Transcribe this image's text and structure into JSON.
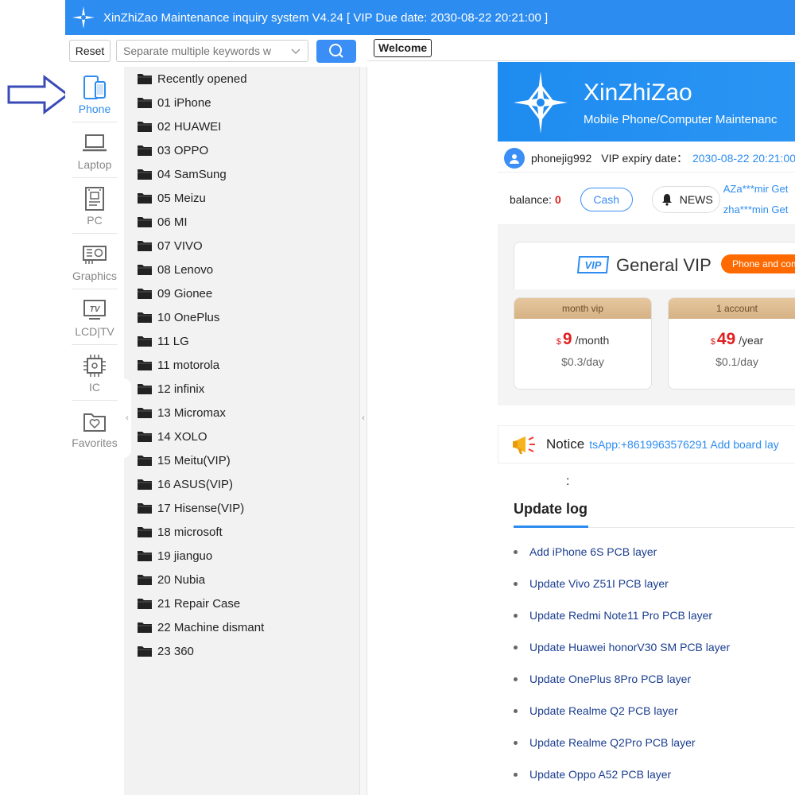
{
  "window": {
    "title": "XinZhiZao Maintenance inquiry system V4.24 [ VIP Due date: 2030-08-22 20:21:00 ]"
  },
  "toolbar": {
    "reset_label": "Reset",
    "search_placeholder": "Separate multiple keywords w"
  },
  "categories": [
    {
      "label": "Phone",
      "icon": "phone-icon",
      "active": true
    },
    {
      "label": "Laptop",
      "icon": "laptop-icon"
    },
    {
      "label": "PC",
      "icon": "motherboard-icon"
    },
    {
      "label": "Graphics",
      "icon": "graphics-card-icon"
    },
    {
      "label": "LCD|TV",
      "icon": "tv-icon"
    },
    {
      "label": "IC",
      "icon": "chip-icon"
    },
    {
      "label": "Favorites",
      "icon": "favorites-icon"
    }
  ],
  "tree": [
    "Recently opened",
    "01 iPhone",
    "02 HUAWEI",
    "03 OPPO",
    "04 SamSung",
    "05 Meizu",
    "06 MI",
    "07 VIVO",
    "08 Lenovo",
    "09 Gionee",
    "10 OnePlus",
    "11 LG",
    "11 motorola",
    "12 infinix",
    "13 Micromax",
    "14 XOLO",
    "15 Meitu(VIP)",
    "16 ASUS(VIP)",
    "17 Hisense(VIP)",
    "18 microsoft",
    "19 jianguo",
    "20 Nubia",
    "21 Repair Case",
    "22 Machine dismant",
    "23 360"
  ],
  "tabs": {
    "welcome": "Welcome"
  },
  "banner": {
    "name": "XinZhiZao",
    "subtitle": "Mobile Phone/Computer Maintenanc"
  },
  "user": {
    "username": "phonejig992",
    "vip_label": "VIP expiry date：",
    "vip_date": "2030-08-22 20:21:00"
  },
  "account": {
    "balance_label": "balance:",
    "balance_value": "0",
    "cash_label": "Cash",
    "news_label": "NEWS",
    "ticker_lines": [
      "AZa***mir Get",
      "zha***min Get"
    ]
  },
  "vip": {
    "badge": "VIP",
    "title": "General VIP",
    "tag": "Phone and com",
    "plans": [
      {
        "name": "month vip",
        "currency": "$",
        "price": "9",
        "unit": "/month",
        "per_day": "$0.3/day"
      },
      {
        "name": "1 account",
        "currency": "$",
        "price": "49",
        "unit": "/year",
        "per_day": "$0.1/day"
      }
    ]
  },
  "notice": {
    "title": "Notice",
    "text": "tsApp:+8619963576291  Add board lay"
  },
  "colon": ":",
  "update_log": {
    "title": "Update log",
    "items": [
      "Add iPhone 6S PCB layer",
      "Update Vivo Z51I PCB layer",
      "Update Redmi Note11 Pro PCB layer",
      "Update Huawei honorV30 SM PCB layer",
      "Update OnePlus 8Pro PCB layer",
      "Update Realme Q2 PCB layer",
      "Update Realme Q2Pro PCB layer",
      "Update Oppo A52 PCB layer"
    ]
  },
  "colors": {
    "primary": "#2d8cf0",
    "titlebar": "#2d8cf0",
    "price_red": "#e02020",
    "tag_orange": "#ff6a00",
    "arrow": "#3a4bb8"
  }
}
